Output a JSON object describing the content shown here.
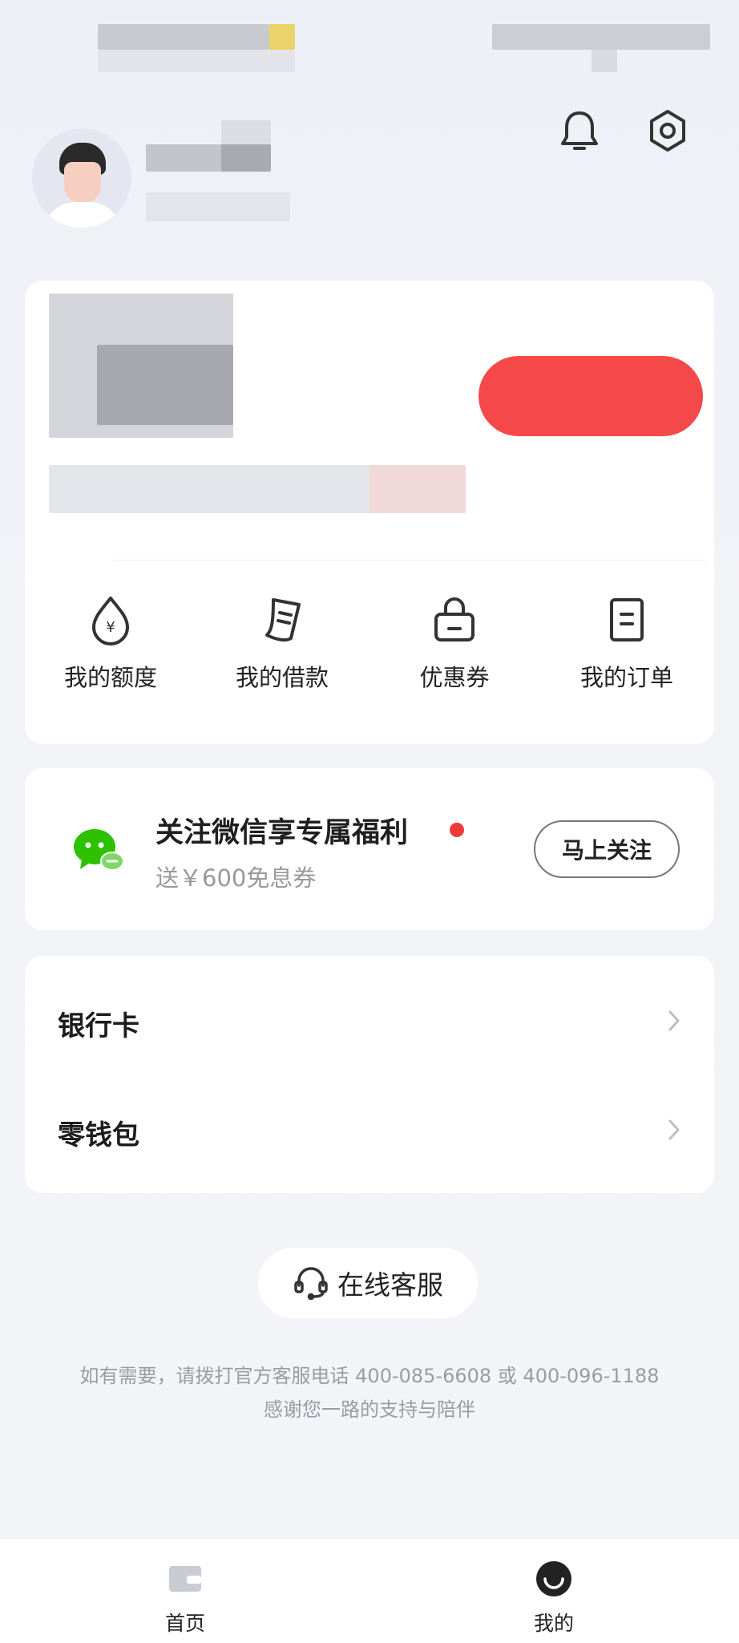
{
  "quick_actions": [
    {
      "label": "我的额度",
      "icon": "money-drop-icon"
    },
    {
      "label": "我的借款",
      "icon": "loan-receipt-icon"
    },
    {
      "label": "优惠券",
      "icon": "coupon-bag-icon"
    },
    {
      "label": "我的订单",
      "icon": "order-document-icon"
    }
  ],
  "wechat_promo": {
    "title": "关注微信享专属福利",
    "subtitle": "送￥600免息券",
    "button": "马上关注",
    "icon": "wechat-icon",
    "badge_color": "#f03a3a"
  },
  "menu": {
    "items": [
      {
        "label": "银行卡"
      },
      {
        "label": "零钱包"
      }
    ]
  },
  "service": {
    "label": "在线客服",
    "icon": "headset-icon"
  },
  "footer": {
    "line1": "如有需要，请拨打官方客服电话 400-085-6608 或 400-096-1188",
    "line2": "感谢您一路的支持与陪伴"
  },
  "tabbar": {
    "tabs": [
      {
        "label": "首页",
        "icon": "wallet-icon"
      },
      {
        "label": "我的",
        "icon": "profile-smile-icon"
      }
    ]
  },
  "colors": {
    "accent_red": "#f03a3a",
    "wechat_green": "#2dc100",
    "background": "#f2f3f7"
  }
}
